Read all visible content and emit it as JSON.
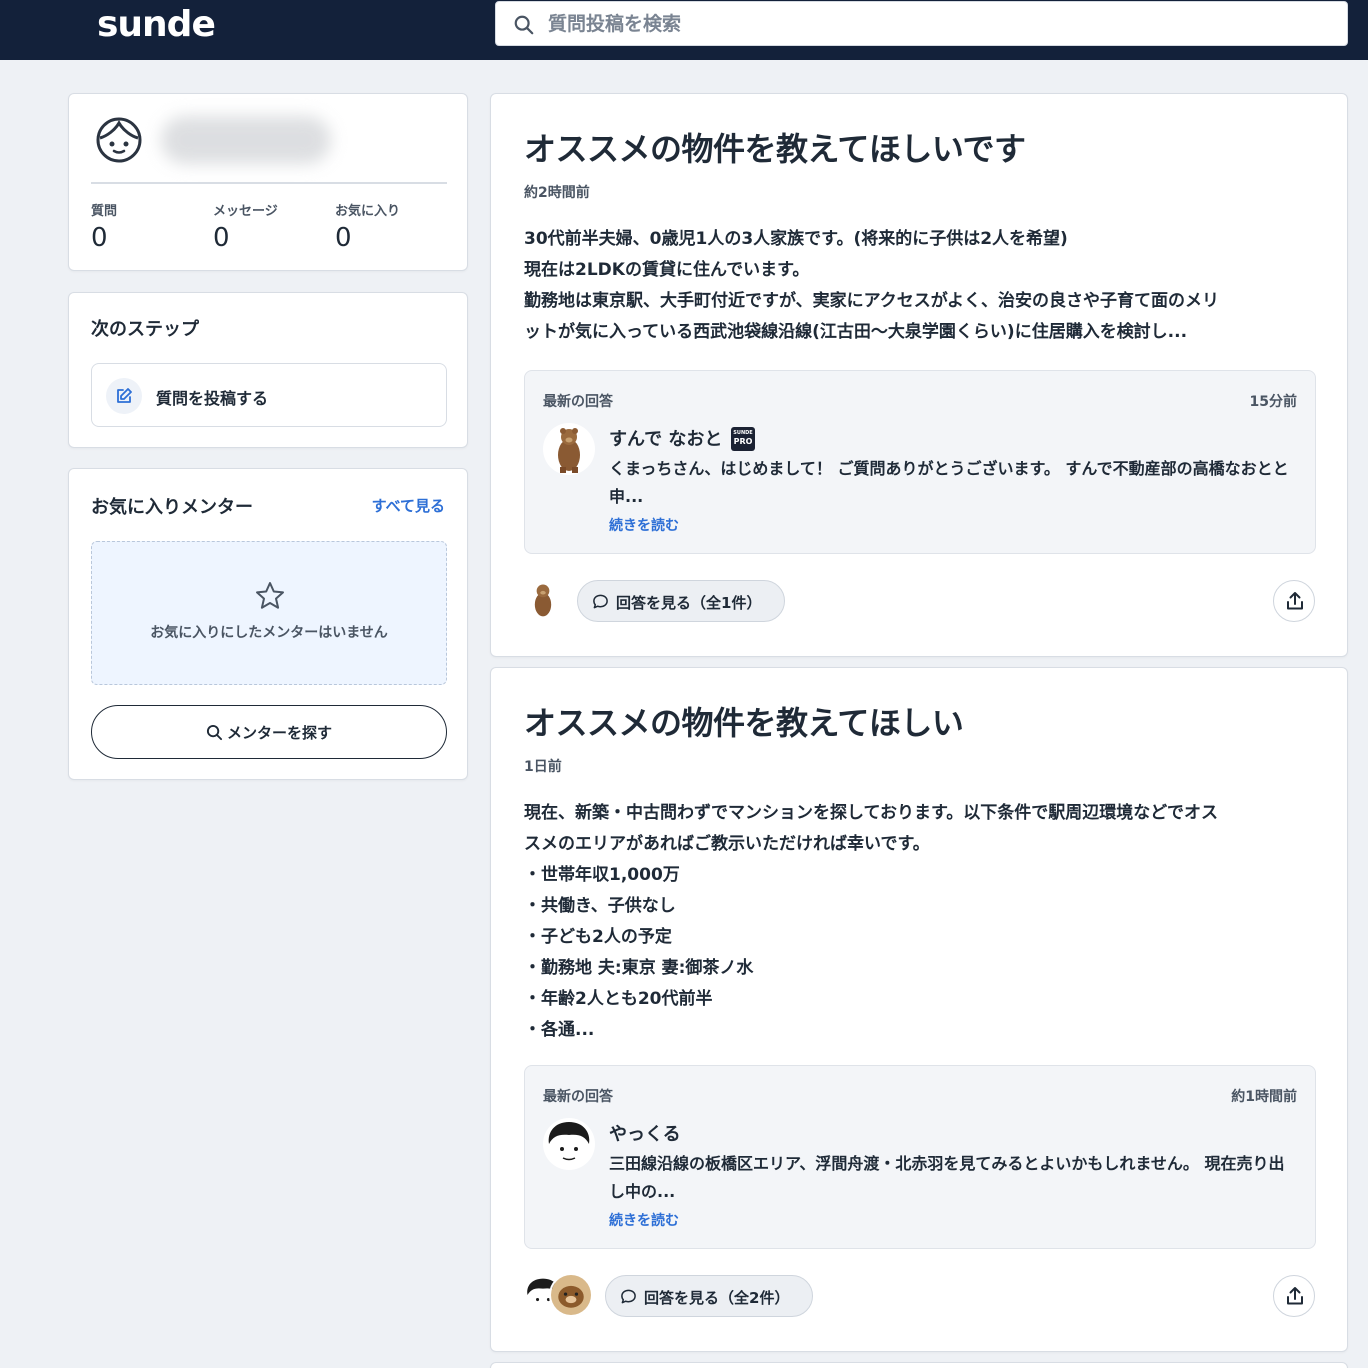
{
  "header": {
    "logo": "sunde",
    "search_placeholder": "質問投稿を検索"
  },
  "profile": {
    "stats": [
      {
        "label": "質問",
        "value": "0"
      },
      {
        "label": "メッセージ",
        "value": "0"
      },
      {
        "label": "お気に入り",
        "value": "0"
      }
    ]
  },
  "next_step": {
    "title": "次のステップ",
    "post_button": "質問を投稿する"
  },
  "favorites": {
    "title": "お気に入りメンター",
    "see_all": "すべて見る",
    "empty_message": "お気に入りにしたメンターはいません",
    "find_button": "メンターを探す"
  },
  "questions": [
    {
      "title": "オススメの物件を教えてほしいです",
      "time": "約2時間前",
      "body": [
        "30代前半夫婦、0歳児1人の3人家族です。(将来的に子供は2人を希望)",
        "現在は2LDKの賃貸に住んでいます。",
        "勤務地は東京駅、大手町付近ですが、実家にアクセスがよく、治安の良さや子育て面のメリ",
        "ットが気に入っている西武池袋線沿線(江古田〜大泉学園くらい)に住居購入を検討し..."
      ],
      "answer": {
        "label": "最新の回答",
        "time": "15分前",
        "name": "すんで なおと",
        "badge_top": "SUNDE",
        "badge_bottom": "PRO",
        "text": "くまっちさん、はじめまして！ ご質問ありがとうございます。 すんで不動産部の高橋なおとと申...",
        "read_more": "続きを読む"
      },
      "view_answers": "回答を見る（全1件）"
    },
    {
      "title": "オススメの物件を教えてほしい",
      "time": "1日前",
      "body": [
        "現在、新築・中古問わずでマンションを探しております。以下条件で駅周辺環境などでオス",
        "スメのエリアがあればご教示いただければ幸いです。",
        "・世帯年収1,000万",
        "・共働き、子供なし",
        "・子ども2人の予定",
        "・勤務地 夫:東京 妻:御茶ノ水",
        "・年齢2人とも20代前半",
        "・各通..."
      ],
      "answer": {
        "label": "最新の回答",
        "time": "約1時間前",
        "name": "やっくる",
        "text": "三田線沿線の板橋区エリア、浮間舟渡・北赤羽を見てみるとよいかもしれません。 現在売り出し中の...",
        "read_more": "続きを読む"
      },
      "view_answers": "回答を見る（全2件）"
    }
  ],
  "colors": {
    "header_bg": "#13213a",
    "page_bg": "#eef1f5",
    "link": "#2d6fd6",
    "empty_box_bg": "#eef5ff"
  }
}
